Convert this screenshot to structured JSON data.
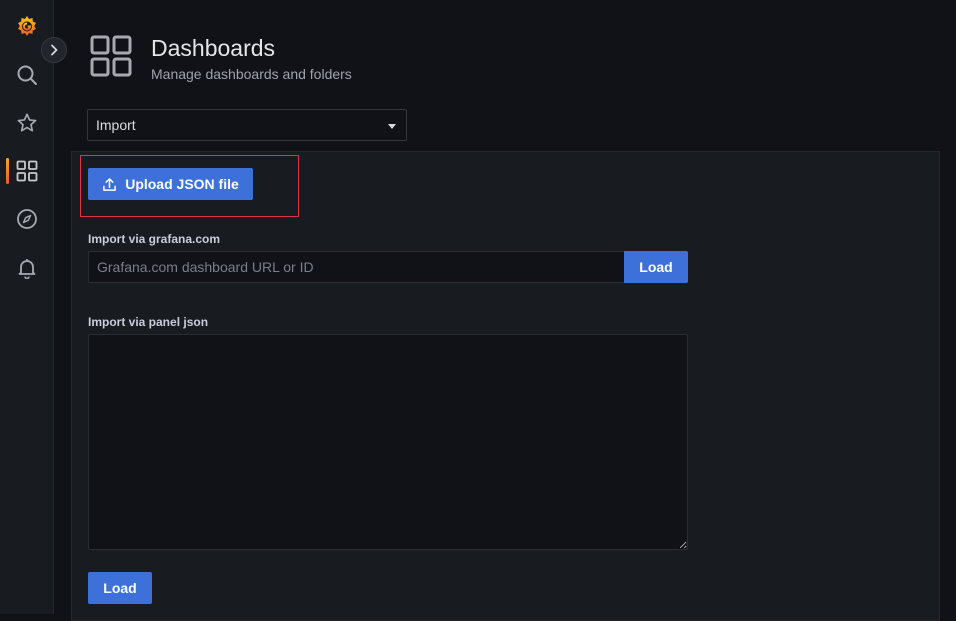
{
  "header": {
    "title": "Dashboards",
    "subtitle": "Manage dashboards and folders"
  },
  "select": {
    "value": "Import"
  },
  "upload": {
    "label": "Upload JSON file"
  },
  "grafana_import": {
    "label": "Import via grafana.com",
    "placeholder": "Grafana.com dashboard URL or ID",
    "value": "",
    "button": "Load"
  },
  "panel_json": {
    "label": "Import via panel json",
    "value": "",
    "button": "Load"
  },
  "colors": {
    "accent": "#3d71d9",
    "highlight": "#e02f44",
    "brand_orange": "#f05a28"
  },
  "sidebar": {
    "items": [
      {
        "icon": "grafana-logo-icon"
      },
      {
        "icon": "search-icon"
      },
      {
        "icon": "star-icon"
      },
      {
        "icon": "dashboards-icon",
        "active": true
      },
      {
        "icon": "explore-compass-icon"
      },
      {
        "icon": "alerting-bell-icon"
      }
    ]
  }
}
